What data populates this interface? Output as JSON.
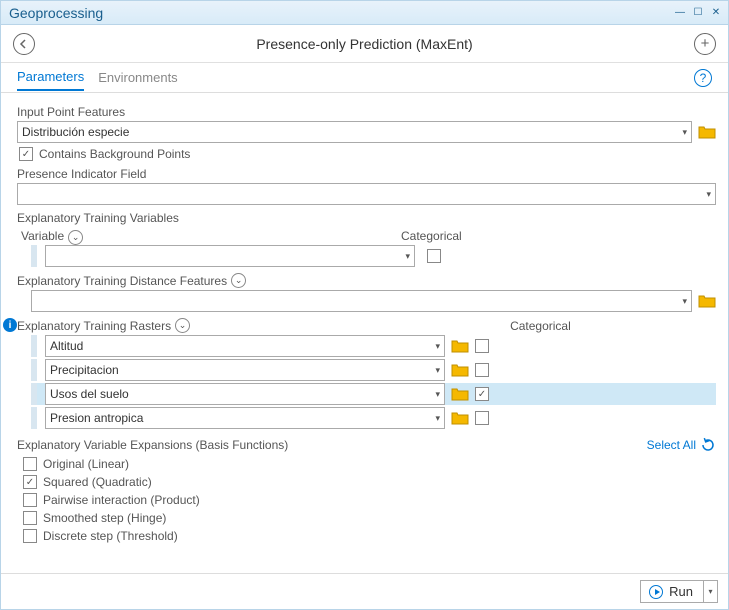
{
  "window": {
    "title": "Geoprocessing"
  },
  "header": {
    "tool_title": "Presence-only Prediction (MaxEnt)"
  },
  "tabs": {
    "active": "Parameters",
    "other": "Environments"
  },
  "params": {
    "input_point_label": "Input Point Features",
    "input_point_value": "Distribución especie",
    "contains_bg_label": "Contains Background Points",
    "contains_bg_checked": true,
    "presence_field_label": "Presence Indicator Field",
    "presence_field_value": "",
    "expl_train_vars_label": "Explanatory Training Variables",
    "variable_label": "Variable",
    "categorical_label": "Categorical",
    "expl_dist_label": "Explanatory Training Distance Features",
    "expl_rasters_label": "Explanatory Training Rasters",
    "rasters": [
      {
        "name": "Altitud",
        "categorical": false
      },
      {
        "name": "Precipitacion",
        "categorical": false
      },
      {
        "name": "Usos del suelo",
        "categorical": true,
        "selected": true
      },
      {
        "name": "Presion antropica",
        "categorical": false
      }
    ],
    "basis_label": "Explanatory Variable Expansions (Basis Functions)",
    "select_all": "Select All",
    "basis": [
      {
        "label": "Original (Linear)",
        "checked": false
      },
      {
        "label": "Squared (Quadratic)",
        "checked": true
      },
      {
        "label": "Pairwise interaction (Product)",
        "checked": false
      },
      {
        "label": "Smoothed step (Hinge)",
        "checked": false
      },
      {
        "label": "Discrete step (Threshold)",
        "checked": false
      }
    ]
  },
  "footer": {
    "run": "Run"
  }
}
